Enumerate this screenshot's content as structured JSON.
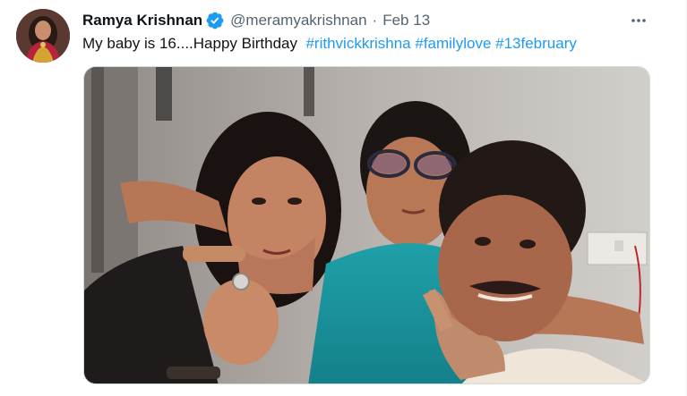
{
  "tweet": {
    "author_name": "Ramya Krishnan",
    "handle": "@meramyakrishnan",
    "separator": "·",
    "date": "Feb 13",
    "text": "My baby is 16....Happy Birthday",
    "hashtags": [
      "#rithvickkrishna",
      "#familylove",
      "#13february"
    ]
  },
  "icons": {
    "verified": "verified-badge-icon",
    "more": "more-options-icon"
  },
  "colors": {
    "link": "#1d9bf0",
    "text": "#0f1419",
    "secondary": "#536471",
    "verified": "#1d9bf0"
  }
}
